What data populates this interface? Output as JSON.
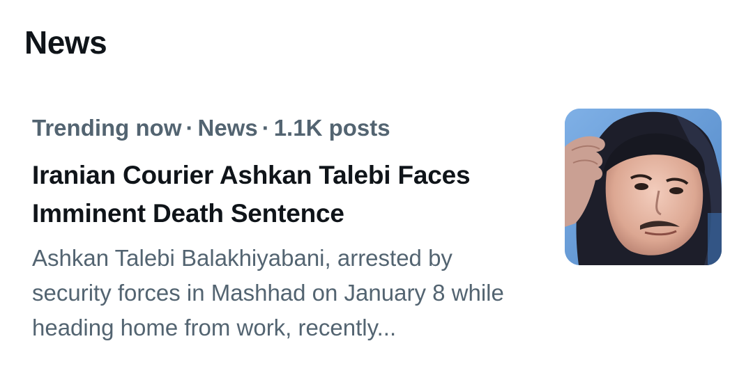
{
  "section": {
    "title": "News"
  },
  "story": {
    "meta": {
      "status": "Trending now",
      "category": "News",
      "posts": "1.1K posts",
      "separator": "·"
    },
    "headline": "Iranian Courier Ashkan Talebi Faces Imminent Death Sentence",
    "summary": "Ashkan Talebi Balakhiyabani, arrested by security forces in Mashhad on January 8 while heading home from work, recently...",
    "thumbnail_icon": "news-photo-thumbnail"
  }
}
